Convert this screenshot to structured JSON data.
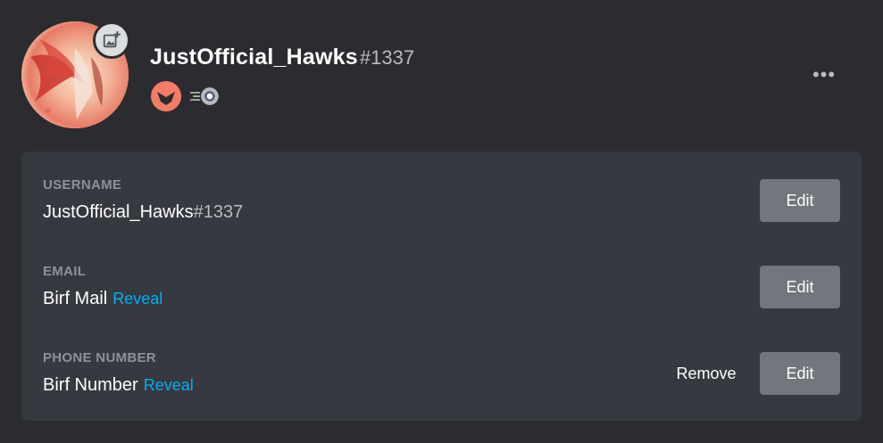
{
  "profile": {
    "username": "JustOfficial_Hawks",
    "discriminator": "#1337",
    "avatar_icon": "avatar-image",
    "upload_icon": "add-image-icon",
    "badges": [
      "hypesquad-brilliance-icon",
      "nitro-boost-icon"
    ],
    "more_label": "•••"
  },
  "account": {
    "username_field": {
      "label": "USERNAME",
      "value": "JustOfficial_Hawks",
      "discriminator": "#1337",
      "edit_label": "Edit"
    },
    "email_field": {
      "label": "EMAIL",
      "value": "Birf Mail",
      "reveal_label": "Reveal",
      "edit_label": "Edit"
    },
    "phone_field": {
      "label": "PHONE NUMBER",
      "value": "Birf Number",
      "reveal_label": "Reveal",
      "remove_label": "Remove",
      "edit_label": "Edit"
    }
  },
  "colors": {
    "background": "#2b2c30",
    "panel": "#36393f",
    "button": "#72767d",
    "link": "#00aff4",
    "label": "#8e9297",
    "muted": "#b9bbbe"
  }
}
